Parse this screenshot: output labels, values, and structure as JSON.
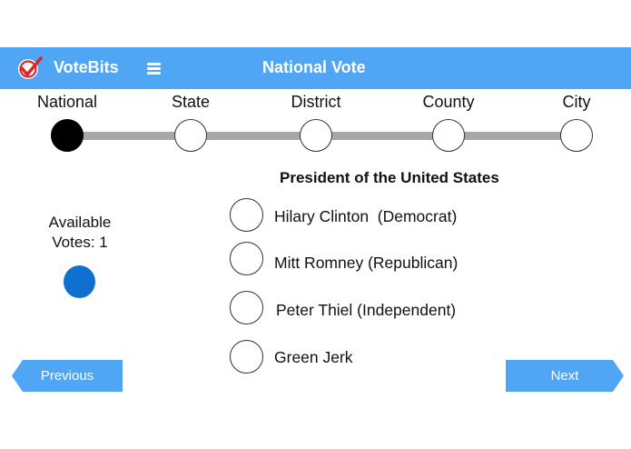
{
  "header": {
    "brand": "VoteBits",
    "title": "National Vote",
    "logo_icon": "checkmark-ballot-icon",
    "menu_icon": "hamburger-menu-icon",
    "color": "#4ea6f5"
  },
  "progress": {
    "steps": [
      {
        "label": "National",
        "active": true
      },
      {
        "label": "State",
        "active": false
      },
      {
        "label": "District",
        "active": false
      },
      {
        "label": "County",
        "active": false
      },
      {
        "label": "City",
        "active": false
      }
    ]
  },
  "ballot": {
    "office": "President of the United States",
    "candidates": [
      {
        "name": "Hilary Clinton  (Democrat)"
      },
      {
        "name": "Mitt Romney (Republican)"
      },
      {
        "name": "Peter Thiel (Independent)"
      },
      {
        "name": "Green Jerk"
      }
    ]
  },
  "votes": {
    "label_line1": "Available",
    "label_line2": "Votes: 1",
    "available": 1,
    "token_color": "#1070d0"
  },
  "nav": {
    "previous": "Previous",
    "next": "Next"
  }
}
